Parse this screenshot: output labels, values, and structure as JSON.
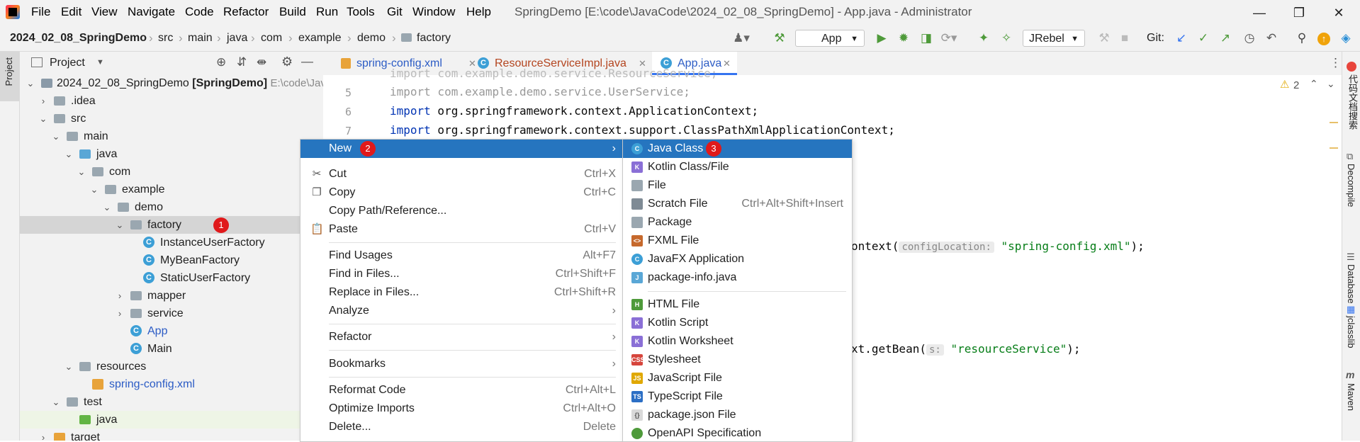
{
  "menubar": {
    "items": [
      "File",
      "Edit",
      "View",
      "Navigate",
      "Code",
      "Refactor",
      "Build",
      "Run",
      "Tools",
      "Git",
      "Window",
      "Help"
    ],
    "window_title": "SpringDemo [E:\\code\\JavaCode\\2024_02_08_SpringDemo] - App.java - Administrator"
  },
  "breadcrumb": [
    "2024_02_08_SpringDemo",
    "src",
    "main",
    "java",
    "com",
    "example",
    "demo",
    "factory"
  ],
  "toolbar": {
    "run_config": "App",
    "jrebel": "JRebel",
    "git_label": "Git:"
  },
  "stripes": {
    "left": [
      "Project"
    ],
    "right": [
      "代码文档搜索",
      "Decompile",
      "Database",
      "jclasslib",
      "Maven"
    ]
  },
  "project_panel": {
    "title": "Project",
    "tree": [
      {
        "label": "2024_02_08_SpringDemo",
        "bold": "[SpringDemo]",
        "path": "E:\\code\\Java"
      },
      {
        "label": ".idea"
      },
      {
        "label": "src"
      },
      {
        "label": "main"
      },
      {
        "label": "java"
      },
      {
        "label": "com"
      },
      {
        "label": "example"
      },
      {
        "label": "demo"
      },
      {
        "label": "factory",
        "badge": "1"
      },
      {
        "label": "InstanceUserFactory"
      },
      {
        "label": "MyBeanFactory"
      },
      {
        "label": "StaticUserFactory"
      },
      {
        "label": "mapper"
      },
      {
        "label": "service"
      },
      {
        "label": "App"
      },
      {
        "label": "Main"
      },
      {
        "label": "resources"
      },
      {
        "label": "spring-config.xml"
      },
      {
        "label": "test"
      },
      {
        "label": "java"
      },
      {
        "label": "target"
      }
    ]
  },
  "editor": {
    "tabs": [
      "spring-config.xml",
      "ResourceServiceImpl.java",
      "App.java"
    ],
    "warnings": "2",
    "line_numbers": [
      "5",
      "6",
      "7"
    ],
    "lines": {
      "l4": "import com.example.demo.service.ResourceService;",
      "l5_kw": "import",
      "l5_rest": " com.example.demo.service.UserService;",
      "l6_kw": "import",
      "l6_rest": " org.springframework.context.ApplicationContext;",
      "l7_kw": "import",
      "l7_rest": " org.springframework.context.support.ClassPathXmlApplicationContext;",
      "ctx_prefix": "ontext(",
      "ctx_hint": "configLocation:",
      "ctx_str": "\"spring-config.xml\"",
      "ctx_end": ");",
      "bean_prefix": "xt.getBean(",
      "bean_hint": "s:",
      "bean_str": "\"resourceService\"",
      "bean_end": ");"
    }
  },
  "context_menu": {
    "items": [
      {
        "label": "New",
        "badge": "2",
        "submenu": true
      },
      {
        "label": "Cut",
        "shortcut": "Ctrl+X",
        "icon": "cut-icon"
      },
      {
        "label": "Copy",
        "shortcut": "Ctrl+C",
        "icon": "copy-icon"
      },
      {
        "label": "Copy Path/Reference..."
      },
      {
        "label": "Paste",
        "shortcut": "Ctrl+V",
        "icon": "paste-icon"
      },
      {
        "label": "Find Usages",
        "shortcut": "Alt+F7"
      },
      {
        "label": "Find in Files...",
        "shortcut": "Ctrl+Shift+F"
      },
      {
        "label": "Replace in Files...",
        "shortcut": "Ctrl+Shift+R"
      },
      {
        "label": "Analyze",
        "submenu": true
      },
      {
        "label": "Refactor",
        "submenu": true
      },
      {
        "label": "Bookmarks",
        "submenu": true
      },
      {
        "label": "Reformat Code",
        "shortcut": "Ctrl+Alt+L"
      },
      {
        "label": "Optimize Imports",
        "shortcut": "Ctrl+Alt+O"
      },
      {
        "label": "Delete...",
        "shortcut": "Delete"
      }
    ]
  },
  "new_submenu": {
    "items": [
      {
        "label": "Java Class",
        "badge": "3"
      },
      {
        "label": "Kotlin Class/File"
      },
      {
        "label": "File"
      },
      {
        "label": "Scratch File",
        "shortcut": "Ctrl+Alt+Shift+Insert"
      },
      {
        "label": "Package"
      },
      {
        "label": "FXML File"
      },
      {
        "label": "JavaFX Application"
      },
      {
        "label": "package-info.java"
      },
      {
        "label": "HTML File"
      },
      {
        "label": "Kotlin Script"
      },
      {
        "label": "Kotlin Worksheet"
      },
      {
        "label": "Stylesheet"
      },
      {
        "label": "JavaScript File"
      },
      {
        "label": "TypeScript File"
      },
      {
        "label": "package.json File"
      },
      {
        "label": "OpenAPI Specification"
      }
    ]
  },
  "colors": {
    "selection": "#2675bf",
    "badge": "#e0191b",
    "accent": "#3574f0"
  }
}
